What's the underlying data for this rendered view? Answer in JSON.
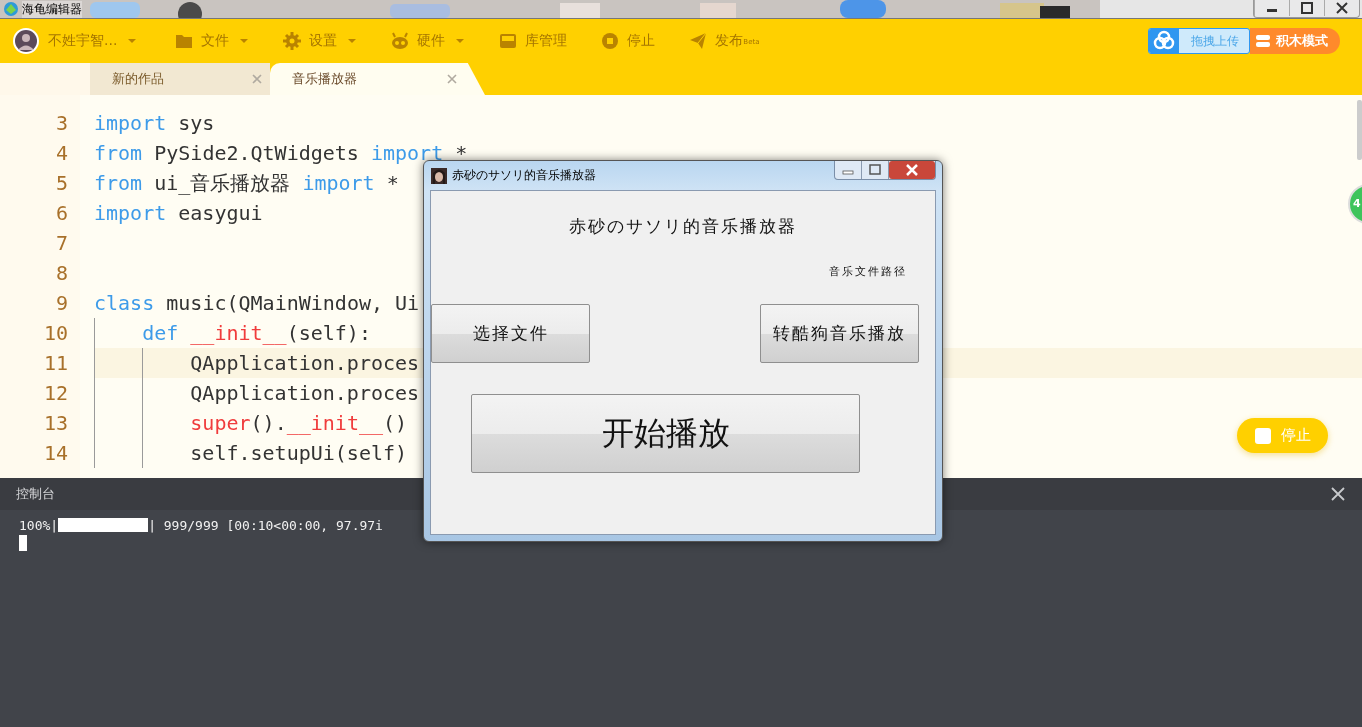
{
  "window": {
    "title": "海龟编辑器"
  },
  "user": {
    "name": "不姓宇智..."
  },
  "toolbar": [
    {
      "kind": "folder",
      "label": "文件",
      "has_menu": true
    },
    {
      "kind": "gear",
      "label": "设置",
      "has_menu": true
    },
    {
      "kind": "robot",
      "label": "硬件",
      "has_menu": true
    },
    {
      "kind": "box",
      "label": "库管理",
      "has_menu": false
    },
    {
      "kind": "stop",
      "label": "停止",
      "has_menu": false
    },
    {
      "kind": "plane",
      "label": "发布",
      "badge": "Beta",
      "has_menu": false
    }
  ],
  "upload_button": {
    "label": "拖拽上传"
  },
  "mode_button": {
    "label": "积木模式"
  },
  "tabs": [
    {
      "label": "新的作品",
      "selected": false
    },
    {
      "label": "音乐播放器",
      "selected": true
    }
  ],
  "editor": {
    "lines": [
      {
        "number": "3",
        "highlighted": false,
        "tokens": [
          {
            "kind": "keyword",
            "text": "import"
          },
          {
            "kind": "plain",
            "text": " sys"
          }
        ]
      },
      {
        "number": "4",
        "highlighted": false,
        "tokens": [
          {
            "kind": "keyword",
            "text": "from"
          },
          {
            "kind": "plain",
            "text": " PySide2.QtWidgets "
          },
          {
            "kind": "keyword",
            "text": "import"
          },
          {
            "kind": "plain",
            "text": " *"
          }
        ]
      },
      {
        "number": "5",
        "highlighted": false,
        "tokens": [
          {
            "kind": "keyword",
            "text": "from"
          },
          {
            "kind": "plain",
            "text": " ui_音乐播放器 "
          },
          {
            "kind": "keyword",
            "text": "import"
          },
          {
            "kind": "plain",
            "text": " *"
          }
        ]
      },
      {
        "number": "6",
        "highlighted": false,
        "tokens": [
          {
            "kind": "keyword",
            "text": "import"
          },
          {
            "kind": "plain",
            "text": " easygui"
          }
        ]
      },
      {
        "number": "7",
        "highlighted": false
      },
      {
        "number": "8",
        "highlighted": false
      },
      {
        "number": "9",
        "highlighted": false,
        "tokens": [
          {
            "kind": "keyword",
            "text": "class"
          },
          {
            "kind": "plain",
            "text": " music(QMainWindow, Ui"
          }
        ]
      },
      {
        "number": "10",
        "highlighted": false,
        "tokens": [
          {
            "kind": "keyword",
            "text": "    def "
          },
          {
            "kind": "special",
            "text": "__init__"
          },
          {
            "kind": "plain",
            "text": "(self):"
          }
        ]
      },
      {
        "number": "11",
        "highlighted": true,
        "tokens": [
          {
            "kind": "plain",
            "text": "        QApplication.proces"
          }
        ]
      },
      {
        "number": "12",
        "highlighted": false,
        "tokens": [
          {
            "kind": "plain",
            "text": "        QApplication.proces"
          }
        ]
      },
      {
        "number": "13",
        "highlighted": false,
        "tokens": [
          {
            "kind": "special",
            "text": "        super"
          },
          {
            "kind": "plain",
            "text": "()."
          },
          {
            "kind": "special",
            "text": "__init__"
          },
          {
            "kind": "plain",
            "text": "()"
          }
        ]
      },
      {
        "number": "14",
        "highlighted": false,
        "tokens": [
          {
            "kind": "plain",
            "text": "        self.setupUi(self)"
          }
        ]
      }
    ]
  },
  "floating_stop": {
    "label": "停止"
  },
  "floating_ball": {
    "label": "4"
  },
  "console": {
    "title": "控制台",
    "prefix": "100%|",
    "progress": {
      "level": 1
    },
    "suffix": "| 999/999 [00:10<00:00, 97.97i"
  },
  "dialog": {
    "title": "赤砂のサソリ的音乐播放器",
    "heading": "赤砂のサソリ的音乐播放器",
    "path_label": "音乐文件路径",
    "buttons": [
      {
        "kind": "choose",
        "label": "选择文件"
      },
      {
        "kind": "kugou",
        "label": "转酷狗音乐播放"
      },
      {
        "kind": "play",
        "label": "开始播放"
      }
    ]
  }
}
